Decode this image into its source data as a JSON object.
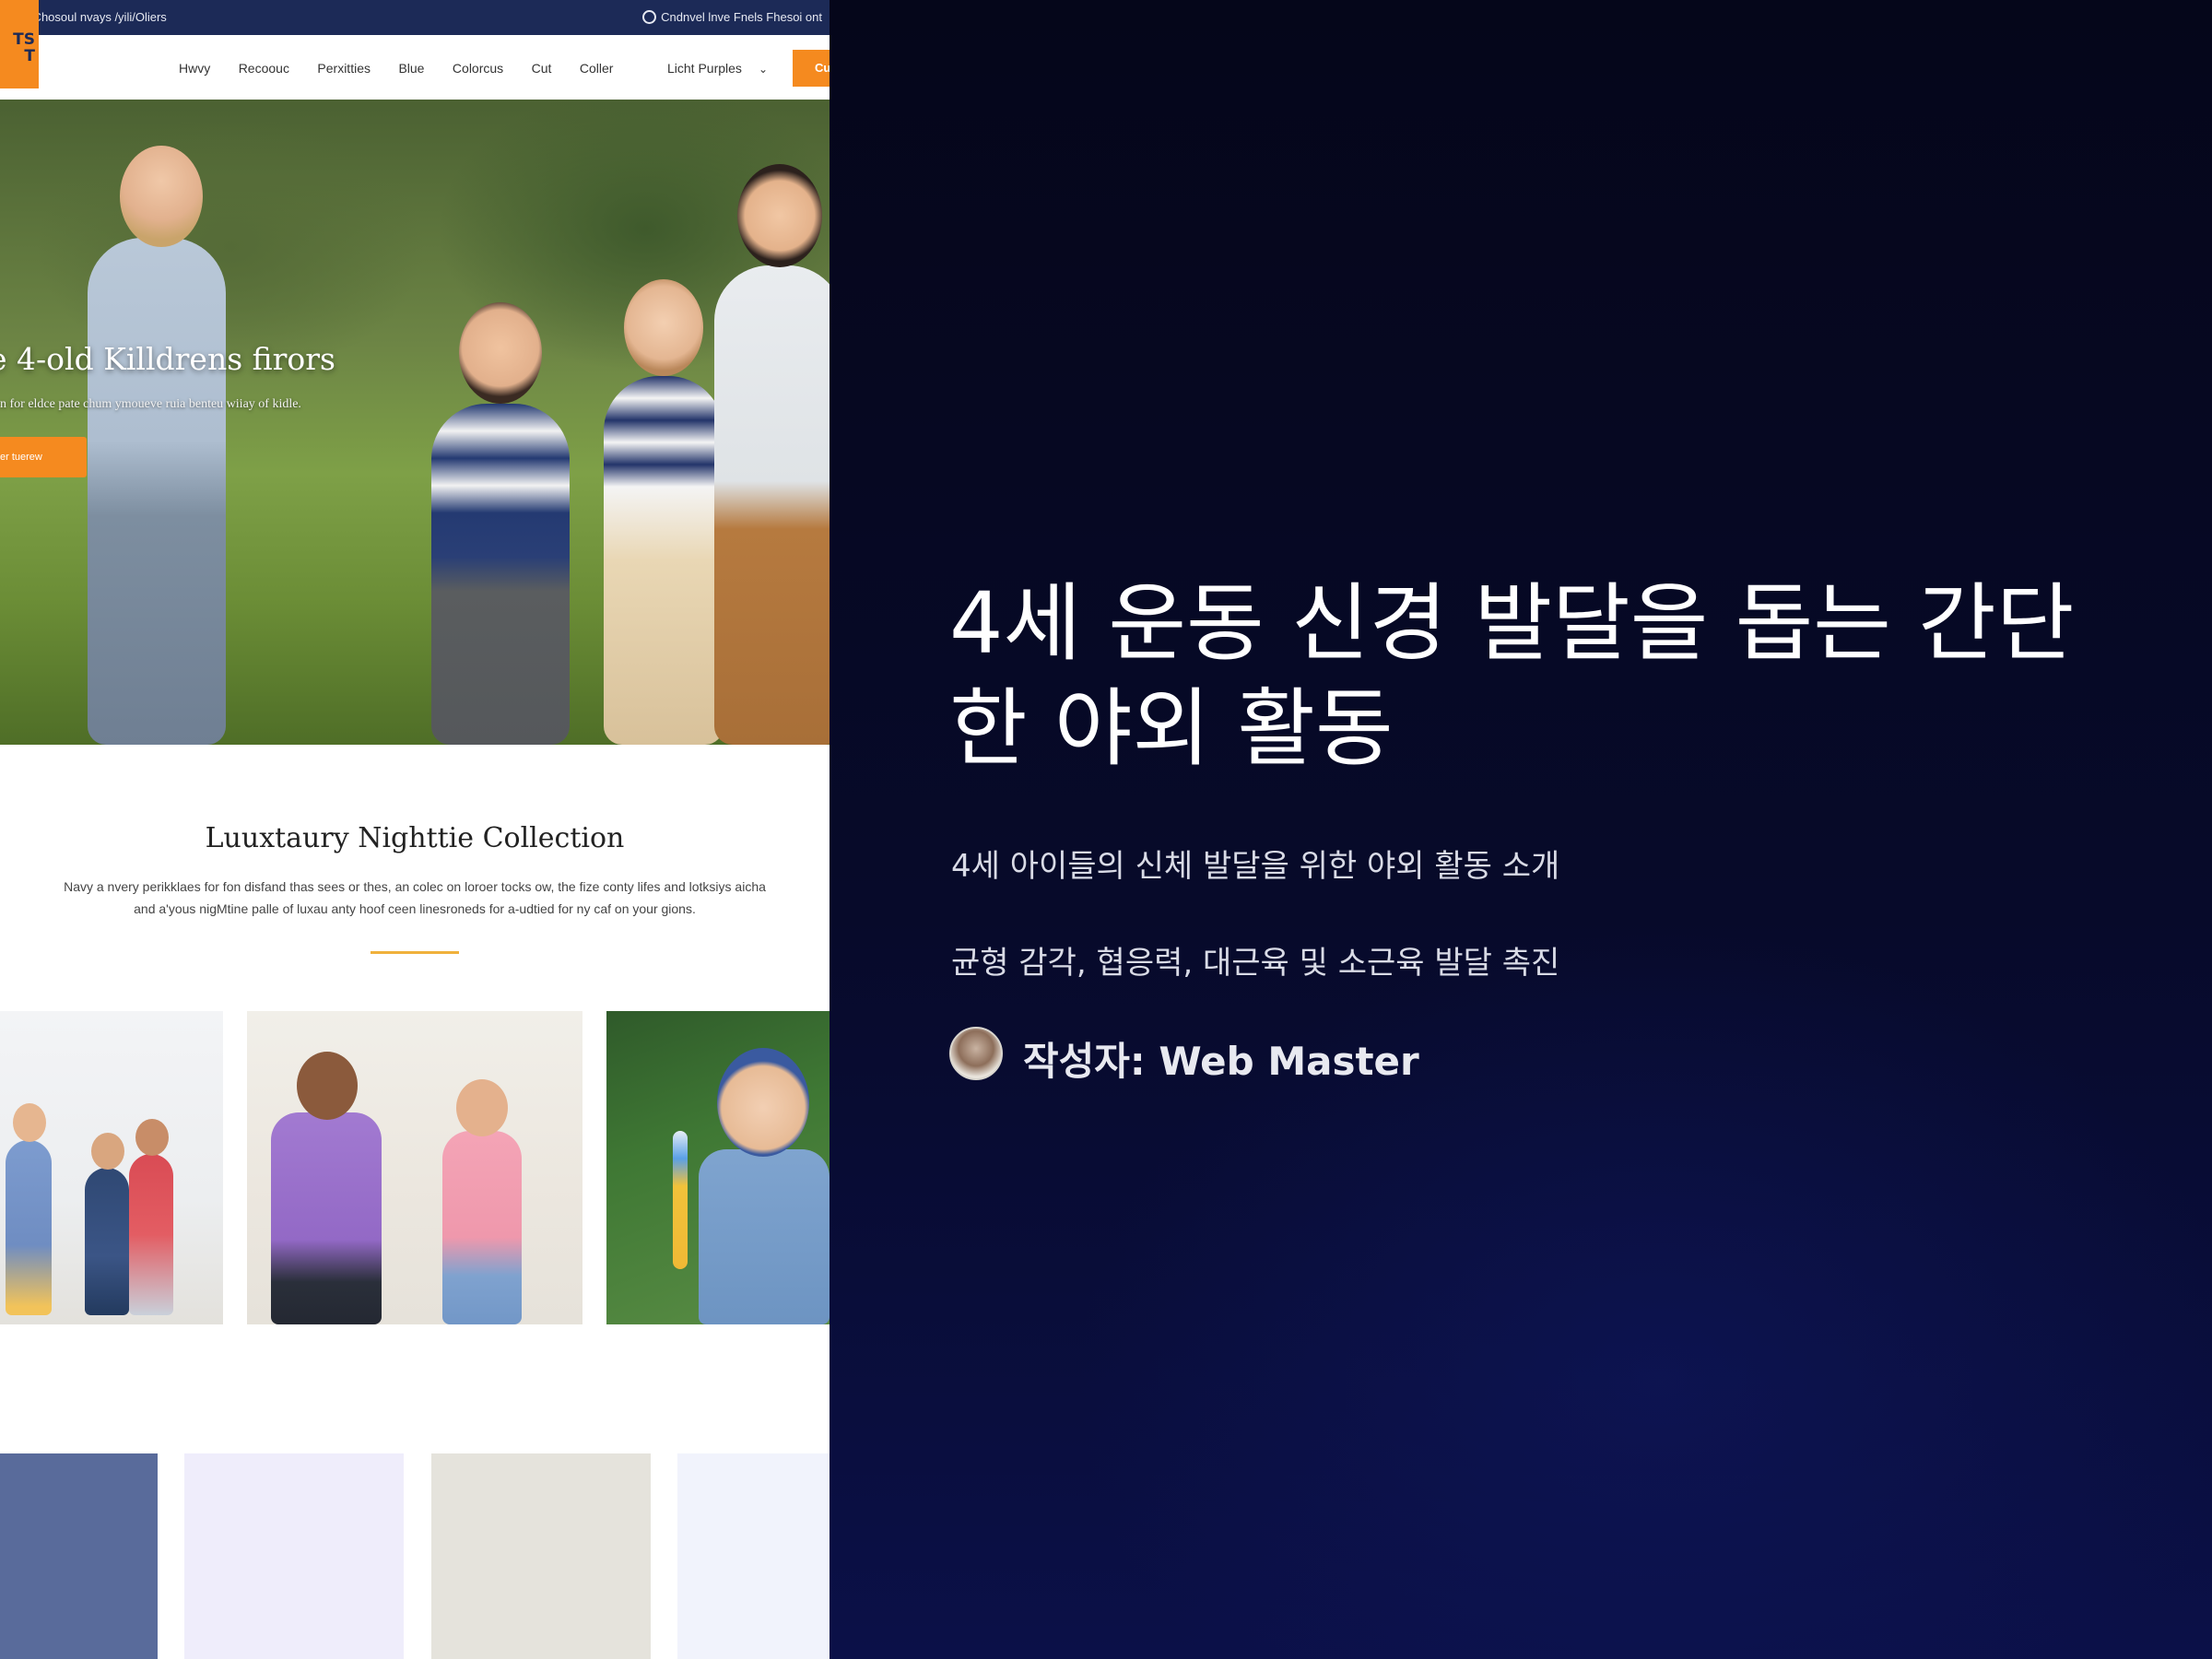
{
  "site": {
    "topbar": {
      "breadcrumb": "oos | Chosoul nvays /yili/Oliers",
      "notice": "Cndnvel lnve Fnels Fhesoi ont"
    },
    "logo_text": "TS\nT",
    "nav": {
      "links": [
        "Hwvy",
        "Recoouc",
        "Perxitties",
        "Blue",
        "Colorcus",
        "Cut",
        "Coller"
      ],
      "select_value": "Licht Purples",
      "cta_label": "Cu"
    },
    "hero": {
      "title": "e 4-old Killdrens firors",
      "subtitle": "n for eldce pate chum ymoueve ruia benteu wiiay of kidle.",
      "button_label": "er tuerew"
    },
    "collection": {
      "title": "Luuxtaury Nighttie Collection",
      "description_line1": "Navy a nvery perikklaes for fon disfand thas sees or thes, an colec on loroer tocks ow, the fize conty lifes and lotksiys aicha",
      "description_line2": "and a'yous nigMtine palle of luxau anty hoof ceen linesroneds for a-udtied for ny caf on your gions."
    },
    "swatches": [
      "#596b9b",
      "#efedfb",
      "#e5e3dc",
      "#f1f3fc"
    ]
  },
  "card": {
    "title": "4세 운동 신경 발달을 돕는 간단한 야외 활동",
    "subtitle": "4세 아이들의 신체 발달을 위한 야외 활동 소개",
    "subtitle2": "균형 감각, 협응력, 대근육 및 소근육 발달 촉진",
    "author_label": "작성자: Web Master",
    "background_color": "#05061a",
    "accent_color": "#f58a1f"
  }
}
